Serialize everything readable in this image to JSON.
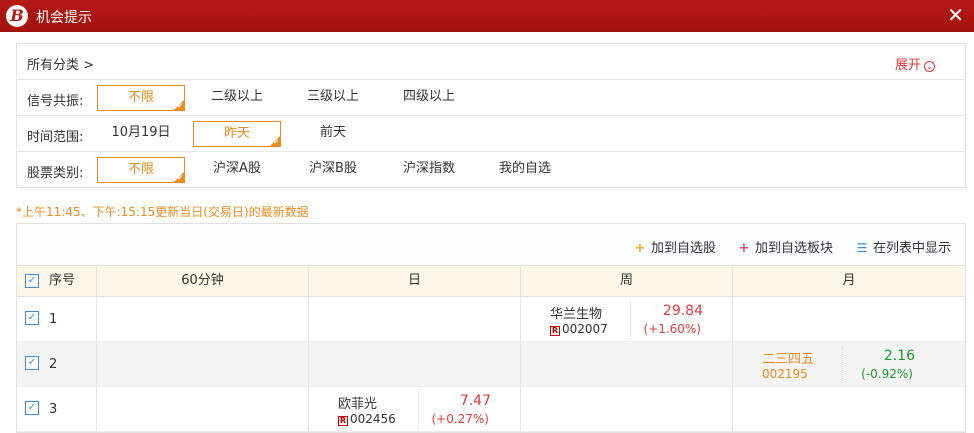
{
  "window": {
    "title": "机会提示",
    "logo": "B",
    "close": "✕"
  },
  "filters": {
    "all_categories": "所有分类 >",
    "expand": "展开",
    "signal": {
      "label": "信号共振:",
      "options": [
        "不限",
        "二级以上",
        "三级以上",
        "四级以上"
      ],
      "selected": 0
    },
    "time": {
      "label": "时间范围:",
      "options": [
        "10月19日",
        "昨天",
        "前天"
      ],
      "selected": 1
    },
    "stock_type": {
      "label": "股票类别:",
      "options": [
        "不限",
        "沪深A股",
        "沪深B股",
        "沪深指数",
        "我的自选"
      ],
      "selected": 0
    }
  },
  "note": "*上午11:45、下午:15:15更新当日(交易日)的最新数据",
  "toolbar": {
    "add_watch": "加到自选股",
    "add_block": "加到自选板块",
    "show_list": "在列表中显示"
  },
  "table": {
    "columns": [
      "序号",
      "60分钟",
      "日",
      "周",
      "月"
    ],
    "rows": [
      {
        "seq": "1",
        "cells": [
          null,
          null,
          {
            "name": "华兰生物",
            "code": "002007",
            "price": "29.84",
            "change": "(+1.60%)",
            "trend": "up"
          },
          null
        ]
      },
      {
        "seq": "2",
        "cells": [
          null,
          null,
          null,
          {
            "name": "二三四五",
            "code": "002195",
            "price": "2.16",
            "change": "(-0.92%)",
            "trend": "down"
          }
        ]
      },
      {
        "seq": "3",
        "cells": [
          null,
          {
            "name": "欧菲光",
            "code": "002456",
            "price": "7.47",
            "change": "(+0.27%)",
            "trend": "up"
          },
          null,
          null
        ]
      }
    ]
  },
  "colors": {
    "titlebar": "#b51a12",
    "accent": "#f08a1d",
    "up": "#e4393c",
    "down": "#1a9a2a",
    "header_bg": "#fcf7e6"
  }
}
